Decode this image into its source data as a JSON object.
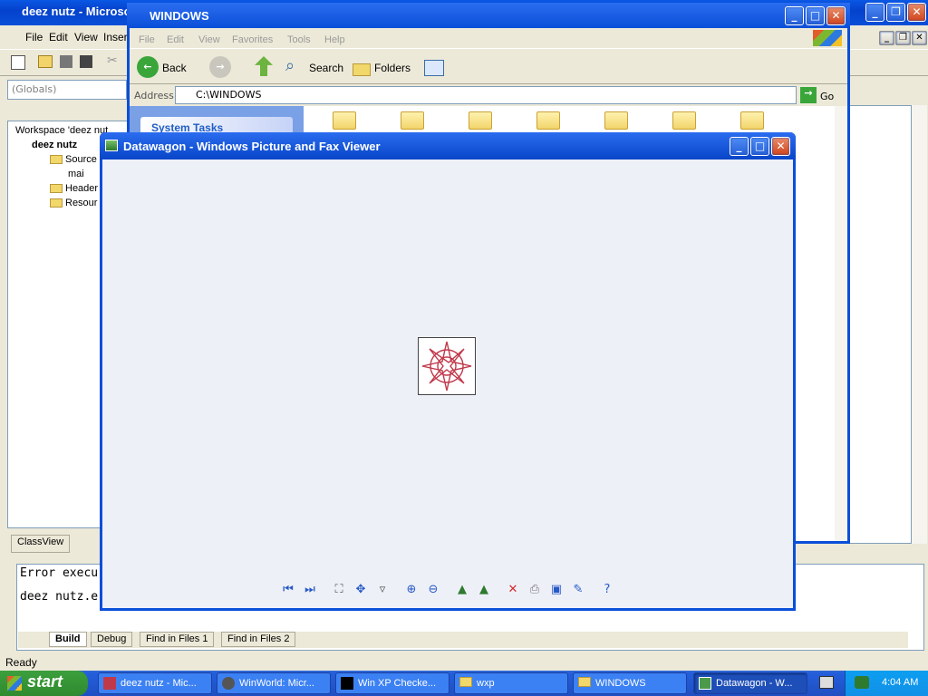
{
  "vc": {
    "title": "deez nutz - Microso",
    "menu": [
      "File",
      "Edit",
      "View",
      "Inser"
    ],
    "globals": "(Globals)",
    "workspace": [
      "Workspace 'deez nut",
      "deez nutz",
      "Source",
      "mai",
      "Header",
      "Resour"
    ],
    "ws_tab": "ClassView",
    "output_lines": [
      "Error execu",
      "deez nutz.e"
    ],
    "output_tabs": [
      "Build",
      "Debug",
      "Find in Files 1",
      "Find in Files 2"
    ],
    "status": "Ready"
  },
  "explorer": {
    "title": "WINDOWS",
    "menu": [
      "File",
      "Edit",
      "View",
      "Favorites",
      "Tools",
      "Help"
    ],
    "back": "Back",
    "search": "Search",
    "folders": "Folders",
    "address_label": "Address",
    "address": "C:\\WINDOWS",
    "go": "Go",
    "task_title": "System Tasks"
  },
  "viewer": {
    "title": "Datawagon - Windows Picture and Fax Viewer",
    "tools": [
      "previous-icon",
      "next-icon",
      "best-fit-icon",
      "actual-size-icon",
      "slideshow-icon",
      "zoom-in-icon",
      "zoom-out-icon",
      "rotate-cw-icon",
      "rotate-ccw-icon",
      "delete-icon",
      "print-icon",
      "save-icon",
      "edit-icon",
      "help-icon"
    ]
  },
  "taskbar": {
    "start": "start",
    "items": [
      "deez nutz - Mic...",
      "WinWorld: Micr...",
      "Win XP Checke...",
      "wxp",
      "WINDOWS",
      "Datawagon - W..."
    ],
    "time": "4:04 AM"
  },
  "colors": {
    "xp_blue": "#0a4fd8",
    "taskbar": "#245edb",
    "start_green": "#3c9f3c"
  }
}
